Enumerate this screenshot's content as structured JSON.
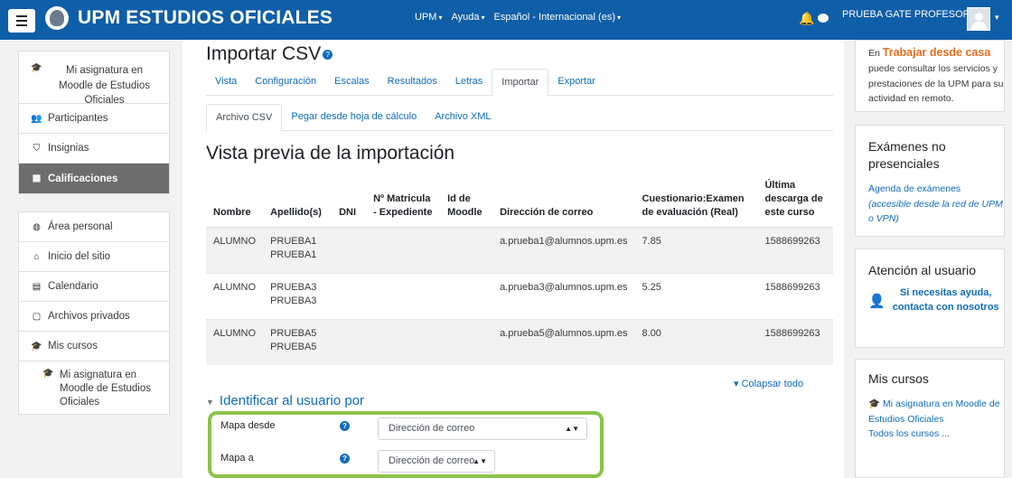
{
  "navbar": {
    "brand": "UPM ESTUDIOS OFICIALES",
    "menu": [
      "UPM",
      "Ayuda",
      "Español - Internacional (es)"
    ],
    "user_name": "PRUEBA GATE PROFESOR"
  },
  "drawer": {
    "course": "Mi asignatura en Moodle de Estudios Oficiales",
    "items": [
      "Participantes",
      "Insignias",
      "Calificaciones"
    ],
    "global": [
      "Área personal",
      "Inicio del sitio",
      "Calendario",
      "Archivos privados",
      "Mis cursos"
    ],
    "course_link": "Mi asignatura en Moodle de Estudios Oficiales"
  },
  "main": {
    "title": "Importar CSV",
    "tabs": [
      "Vista",
      "Configuración",
      "Escalas",
      "Resultados",
      "Letras",
      "Importar",
      "Exportar"
    ],
    "subtabs": [
      "Archivo CSV",
      "Pegar desde hoja de cálculo",
      "Archivo XML"
    ],
    "section_title": "Vista previa de la importación",
    "table": {
      "headers": [
        "Nombre",
        "Apellido(s)",
        "DNI",
        "Nº Matricula - Expediente",
        "Id de Moodle",
        "Dirección de correo",
        "Cuestionario:Examen de evaluación (Real)",
        "Última descarga de este curso"
      ],
      "rows": [
        [
          "ALUMNO",
          "PRUEBA1 PRUEBA1",
          "",
          "",
          "",
          "a.prueba1@alumnos.upm.es",
          "7.85",
          "1588699263"
        ],
        [
          "ALUMNO",
          "PRUEBA3 PRUEBA3",
          "",
          "",
          "",
          "a.prueba3@alumnos.upm.es",
          "5.25",
          "1588699263"
        ],
        [
          "ALUMNO",
          "PRUEBA5 PRUEBA5",
          "",
          "",
          "",
          "a.prueba5@alumnos.upm.es",
          "8.00",
          "1588699263"
        ]
      ]
    },
    "collapse_all": "Colapsar todo",
    "identify_heading": "Identificar al usuario por",
    "map_from_label": "Mapa desde",
    "map_from_value": "Dirección de correo",
    "map_to_label": "Mapa a",
    "map_to_value": "Dirección de correo"
  },
  "right": {
    "block1_pre": "En",
    "block1_highlight": "Trabajar desde casa",
    "block1_text": "puede consultar los servicios y prestaciones de la UPM para su actividad en remoto.",
    "block2_title": "Exámenes no presenciales",
    "block2_link": "Agenda de exámenes",
    "block2_note": "(accesible desde la red de UPM o VPN)",
    "block3_title": "Atención al usuario",
    "block3_link": "Si necesitas ayuda, contacta con nosotros",
    "block4_title": "Mis cursos",
    "block4_course": "Mi asignatura en Moodle de Estudios Oficiales",
    "block4_all": "Todos los cursos ..."
  },
  "colors": {
    "navbar": "#0f5ea8",
    "highlight": "#8bc34a",
    "link": "#0f6cbf",
    "orange": "#e96b1d"
  }
}
